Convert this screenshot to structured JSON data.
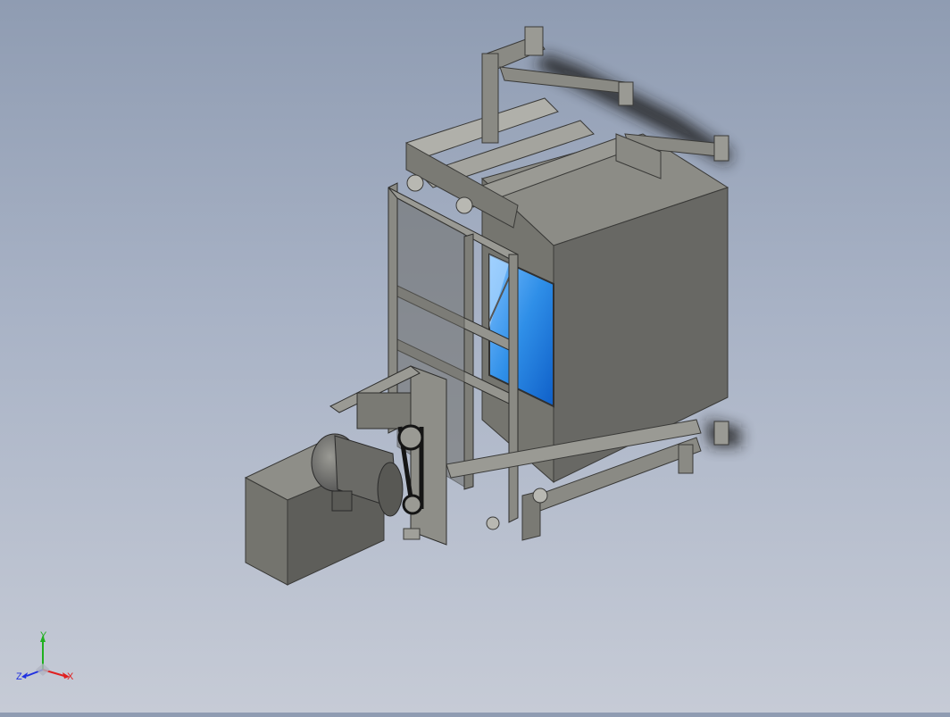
{
  "viewport": {
    "background_top": "#8f9cb2",
    "background_bottom": "#c6cbd6"
  },
  "model": {
    "body_color": "#6f6f6a",
    "frame_color": "#8a8a84",
    "glass_color": "#2f8fe8",
    "shadow_color": "#1e1e1e"
  },
  "triad": {
    "x_label": "X",
    "y_label": "Y",
    "z_label": "Z",
    "x_color": "#e02020",
    "y_color": "#20b020",
    "z_color": "#2030e0"
  }
}
